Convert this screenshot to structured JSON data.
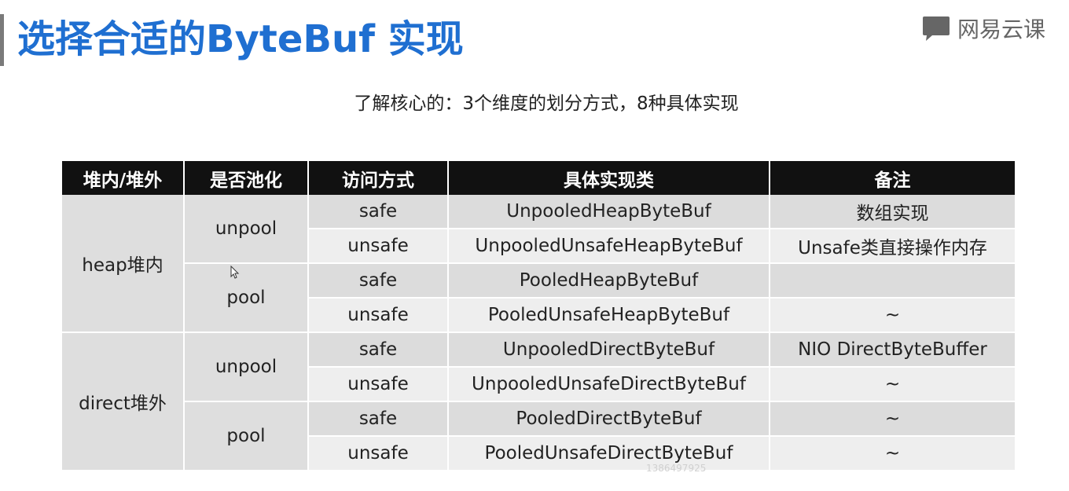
{
  "slide": {
    "title": "选择合适的ByteBuf 实现",
    "subtitle": "了解核心的：3个维度的划分方式，8种具体实现"
  },
  "logo": {
    "text": "网易云课",
    "icon": "speech-book-icon",
    "color": "#666666"
  },
  "colors": {
    "title": "#1f6fd1",
    "header_bg": "#111111",
    "row_dark": "#dcdcdc",
    "row_light": "#eeeeee"
  },
  "table": {
    "headers": [
      "堆内/堆外",
      "是否池化",
      "访问方式",
      "具体实现类",
      "备注"
    ],
    "locations": [
      "heap堆内",
      "direct堆外"
    ],
    "pooling": [
      "unpool",
      "pool",
      "unpool",
      "pool"
    ],
    "rows": [
      {
        "access": "safe",
        "class": "UnpooledHeapByteBuf",
        "note": "数组实现"
      },
      {
        "access": "unsafe",
        "class": "UnpooledUnsafeHeapByteBuf",
        "note": "Unsafe类直接操作内存"
      },
      {
        "access": "safe",
        "class": "PooledHeapByteBuf",
        "note": ""
      },
      {
        "access": "unsafe",
        "class": "PooledUnsafeHeapByteBuf",
        "note": "~"
      },
      {
        "access": "safe",
        "class": "UnpooledDirectByteBuf",
        "note": "NIO DirectByteBuffer"
      },
      {
        "access": "unsafe",
        "class": "UnpooledUnsafeDirectByteBuf",
        "note": "~"
      },
      {
        "access": "safe",
        "class": "PooledDirectByteBuf",
        "note": "~"
      },
      {
        "access": "unsafe",
        "class": "PooledUnsafeDirectByteBuf",
        "note": "~"
      }
    ]
  },
  "watermark": "1386497925"
}
